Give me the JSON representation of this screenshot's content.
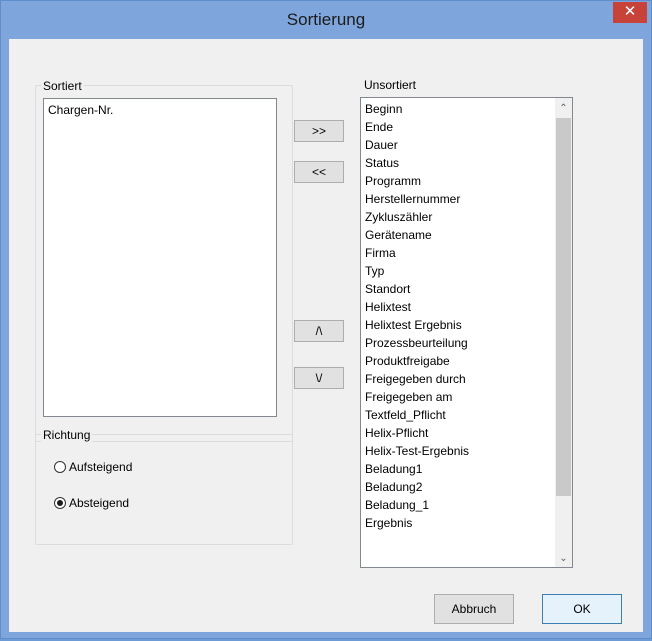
{
  "window": {
    "title": "Sortierung",
    "close_glyph": "✕"
  },
  "sorted": {
    "label": "Sortiert",
    "items": [
      "Chargen-Nr."
    ]
  },
  "unsorted": {
    "label": "Unsortiert",
    "items": [
      "Beginn",
      "Ende",
      "Dauer",
      "Status",
      "Programm",
      "Herstellernummer",
      "Zykluszähler",
      "Gerätename",
      "Firma",
      "Typ",
      "Standort",
      "Helixtest",
      "Helixtest Ergebnis",
      "Prozessbeurteilung",
      "Produktfreigabe",
      "Freigegeben durch",
      "Freigegeben am",
      "Textfeld_Pflicht",
      "Helix-Pflicht",
      "Helix-Test-Ergebnis",
      "Beladung1",
      "Beladung2",
      "Beladung_1",
      "Ergebnis"
    ]
  },
  "transfer": {
    "add_label": ">>",
    "remove_label": "<<",
    "up_label": "/\\",
    "down_label": "\\/"
  },
  "direction": {
    "label": "Richtung",
    "options": [
      {
        "label": "Aufsteigend",
        "checked": false
      },
      {
        "label": "Absteigend",
        "checked": true
      }
    ]
  },
  "footer": {
    "cancel_label": "Abbruch",
    "ok_label": "OK"
  },
  "scroll": {
    "up_glyph": "⌃",
    "down_glyph": "⌄"
  }
}
